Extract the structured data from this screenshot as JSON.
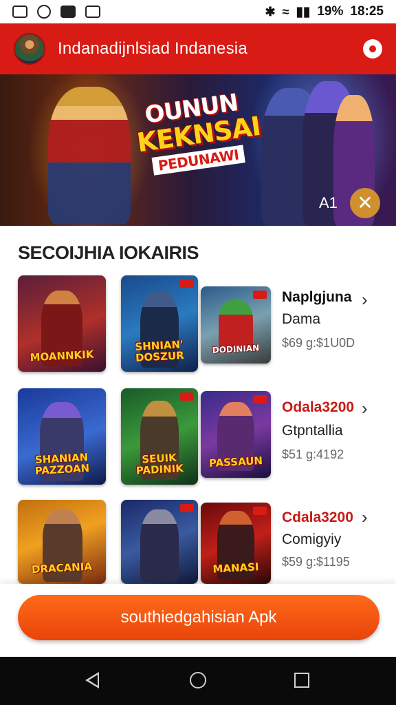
{
  "status_bar": {
    "left_icons": [
      "gallery-icon",
      "timer-icon",
      "camera-icon",
      "screenshot-icon"
    ],
    "bluetooth": "✱",
    "wifi": "≈",
    "battery": "19%",
    "time": "18:25"
  },
  "app_bar": {
    "title": "Indanadijnlsiad Indanesia",
    "avatar_icon": "avatar-icon",
    "settings_icon": "settings-icon",
    "color": "#d81b14"
  },
  "banner": {
    "title_line1": "OUNUN",
    "title_line2": "KEKNSAI",
    "title_line3": "PEDUNAWI",
    "counter": "A1",
    "close_glyph": "✕"
  },
  "section": {
    "title": "SECOIJHIA IOKAIRIS"
  },
  "games": [
    {
      "name": "Naplgjuna",
      "category": "Dama",
      "price": "$69 g:$1U0D",
      "tiles": [
        "MOANNKIK",
        "SHNIAN' DOSZUR",
        "DODINIAN"
      ]
    },
    {
      "name": "Odala3200",
      "category": "Gtpntallia",
      "price": "$51 g:4192",
      "tiles": [
        "SHANIAN PAZZOAN",
        "SEUIK PADINIK",
        "PASSAUN"
      ]
    },
    {
      "name": "Cdala3200",
      "category": "Comigyiy",
      "price": "$59 g:$1195",
      "tiles": [
        "DRACANIA",
        "",
        "MANASI"
      ]
    }
  ],
  "cta": {
    "label": "southiedgahisian Apk"
  },
  "nav": {
    "back_icon": "back-icon",
    "home_icon": "home-icon",
    "recents_icon": "recents-icon"
  },
  "colors": {
    "accent": "#d81b14",
    "cta": "#f05a12",
    "price_red": "#c81a14"
  }
}
